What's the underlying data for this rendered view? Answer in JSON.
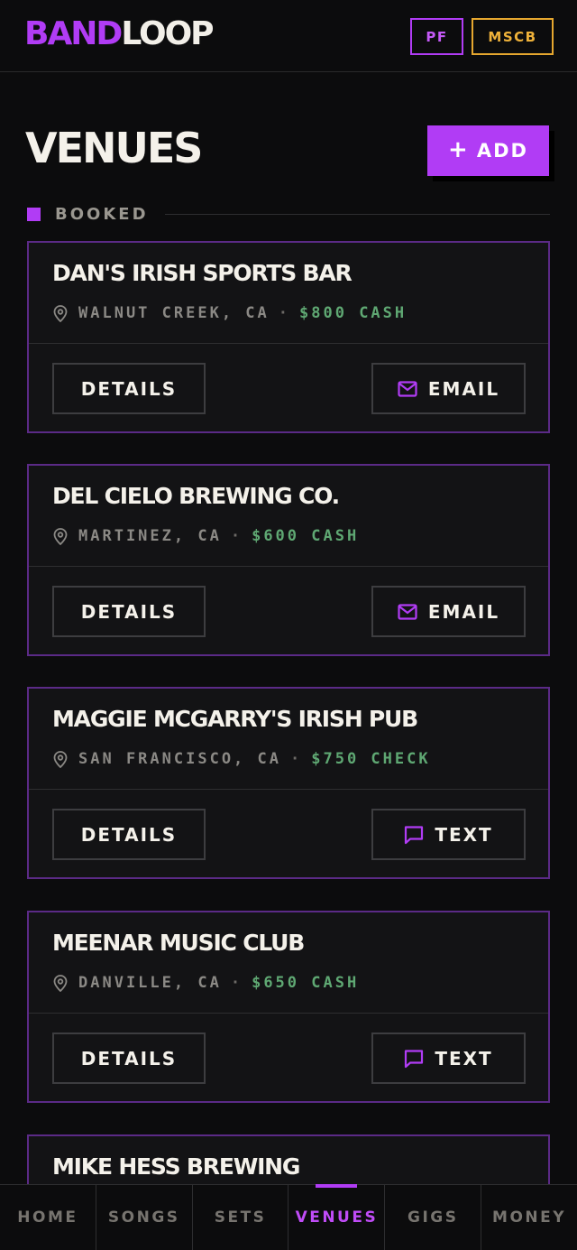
{
  "app": {
    "logo_part1": "BAND",
    "logo_part2": "LOOP",
    "bands": [
      {
        "label": "PF",
        "color": "#b13cf5"
      },
      {
        "label": "MSCB",
        "color": "#e6a72f"
      }
    ]
  },
  "page": {
    "title": "VENUES",
    "add_label": "ADD",
    "add_icon": "plus-icon"
  },
  "section": {
    "label": "BOOKED"
  },
  "venues": [
    {
      "name": "DAN'S IRISH SPORTS BAR",
      "location": "WALNUT CREEK, CA",
      "pay": "$800 CASH",
      "details_label": "DETAILS",
      "contact_label": "EMAIL",
      "contact_icon": "mail-icon"
    },
    {
      "name": "DEL CIELO BREWING CO.",
      "location": "MARTINEZ, CA",
      "pay": "$600 CASH",
      "details_label": "DETAILS",
      "contact_label": "EMAIL",
      "contact_icon": "mail-icon"
    },
    {
      "name": "MAGGIE MCGARRY'S IRISH PUB",
      "location": "SAN FRANCISCO, CA",
      "pay": "$750 CHECK",
      "details_label": "DETAILS",
      "contact_label": "TEXT",
      "contact_icon": "message-icon"
    },
    {
      "name": "MEENAR MUSIC CLUB",
      "location": "DANVILLE, CA",
      "pay": "$650 CASH",
      "details_label": "DETAILS",
      "contact_label": "TEXT",
      "contact_icon": "message-icon"
    },
    {
      "name": "MIKE HESS BREWING"
    }
  ],
  "meta_separator": "·",
  "nav": {
    "items": [
      "HOME",
      "SONGS",
      "SETS",
      "VENUES",
      "GIGS",
      "MONEY"
    ],
    "active": "VENUES"
  },
  "colors": {
    "accent": "#b13cf5",
    "secondary": "#e6a72f",
    "pay_green": "#5fa873",
    "background": "#0c0c0d"
  }
}
